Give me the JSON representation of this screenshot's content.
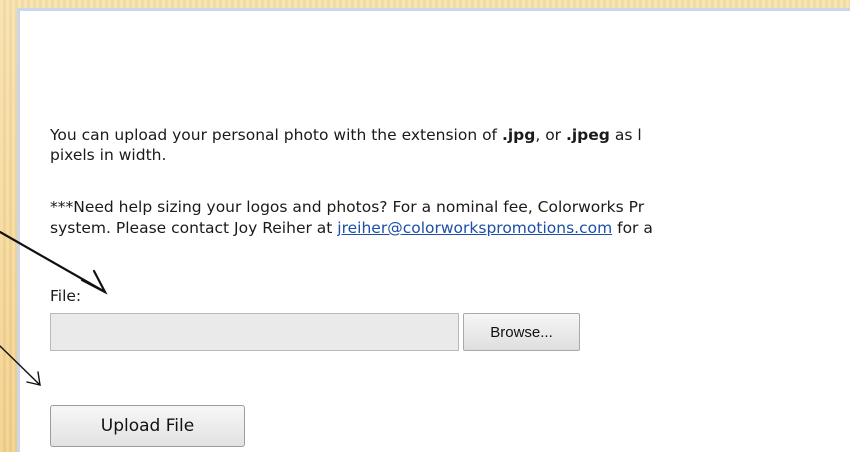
{
  "upload_form": {
    "intro_prefix": "You can upload your personal photo with the extension of ",
    "ext_jpg": ".jpg",
    "intro_mid": ", or ",
    "ext_jpeg": ".jpeg",
    "intro_suffix": " as l",
    "intro_line2": "pixels in width.",
    "help_line1": "***Need help sizing your logos and photos? For a nominal fee, Colorworks Pr",
    "help_line2_prefix": "system. Please contact Joy Reiher at ",
    "help_email": "jreiher@colorworkspromotions.com",
    "help_line2_suffix": " for a",
    "file_label": "File:",
    "file_value": "",
    "browse_label": "Browse...",
    "upload_label": "Upload File"
  },
  "colors": {
    "background": "#f7d899",
    "link": "#1b4fa8",
    "panel_border": "#c9d6ec"
  },
  "icons": [
    "arrow-to-file-label-icon",
    "arrow-to-upload-button-icon"
  ]
}
